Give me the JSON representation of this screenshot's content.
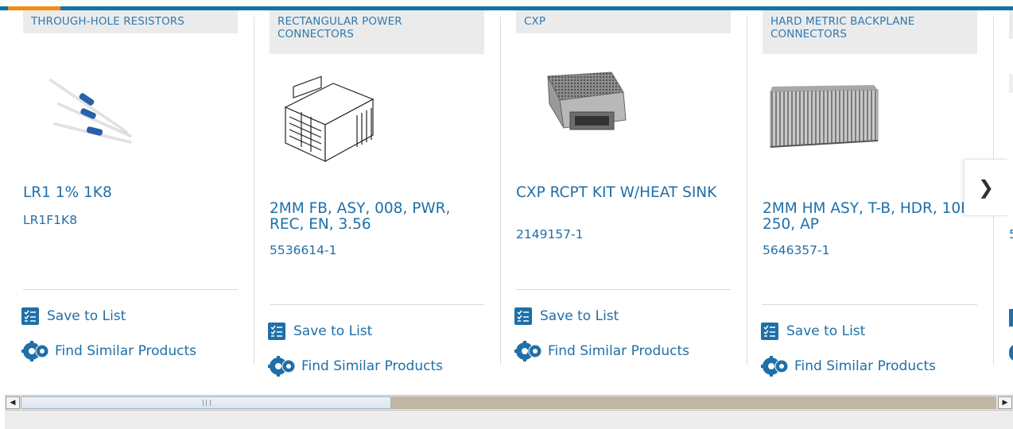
{
  "cards": [
    {
      "category": "THROUGH-HOLE RESISTORS",
      "image_alt": "resistors",
      "name": "LR1 1% 1K8",
      "part_number": "LR1F1K8",
      "save_label": "Save to List",
      "similar_label": "Find Similar Products"
    },
    {
      "category": "RECTANGULAR POWER CONNECTORS",
      "image_alt": "rectangular power connector",
      "name": "2MM FB, ASY, 008, PWR, REC, EN, 3.56",
      "part_number": "5536614-1",
      "save_label": "Save to List",
      "similar_label": "Find Similar Products"
    },
    {
      "category": "CXP",
      "image_alt": "cxp receptacle with heat sink",
      "name": "CXP RCPT KIT W/HEAT SINK",
      "part_number": "2149157-1",
      "save_label": "Save to List",
      "similar_label": "Find Similar Products"
    },
    {
      "category": "HARD METRIC BACKPLANE CONNECTORS",
      "image_alt": "hard metric backplane connector",
      "name": "2MM HM ASY, T-B, HDR, 10R, 250, AP",
      "part_number": "5646357-1",
      "save_label": "Save to List",
      "similar_label": "Find Similar Products"
    },
    {
      "category": "",
      "image_alt": "",
      "name": "",
      "part_number": "5",
      "save_label": "",
      "similar_label": ""
    }
  ],
  "carousel": {
    "next_icon": "chevron-right-icon",
    "next_glyph": "❯"
  },
  "scrollbar": {
    "left_glyph": "◀",
    "right_glyph": "▶",
    "position_fraction": 0.0
  },
  "colors": {
    "accent_blue": "#1172a6",
    "accent_orange": "#f28c12",
    "link_blue": "#1f6fa8"
  }
}
